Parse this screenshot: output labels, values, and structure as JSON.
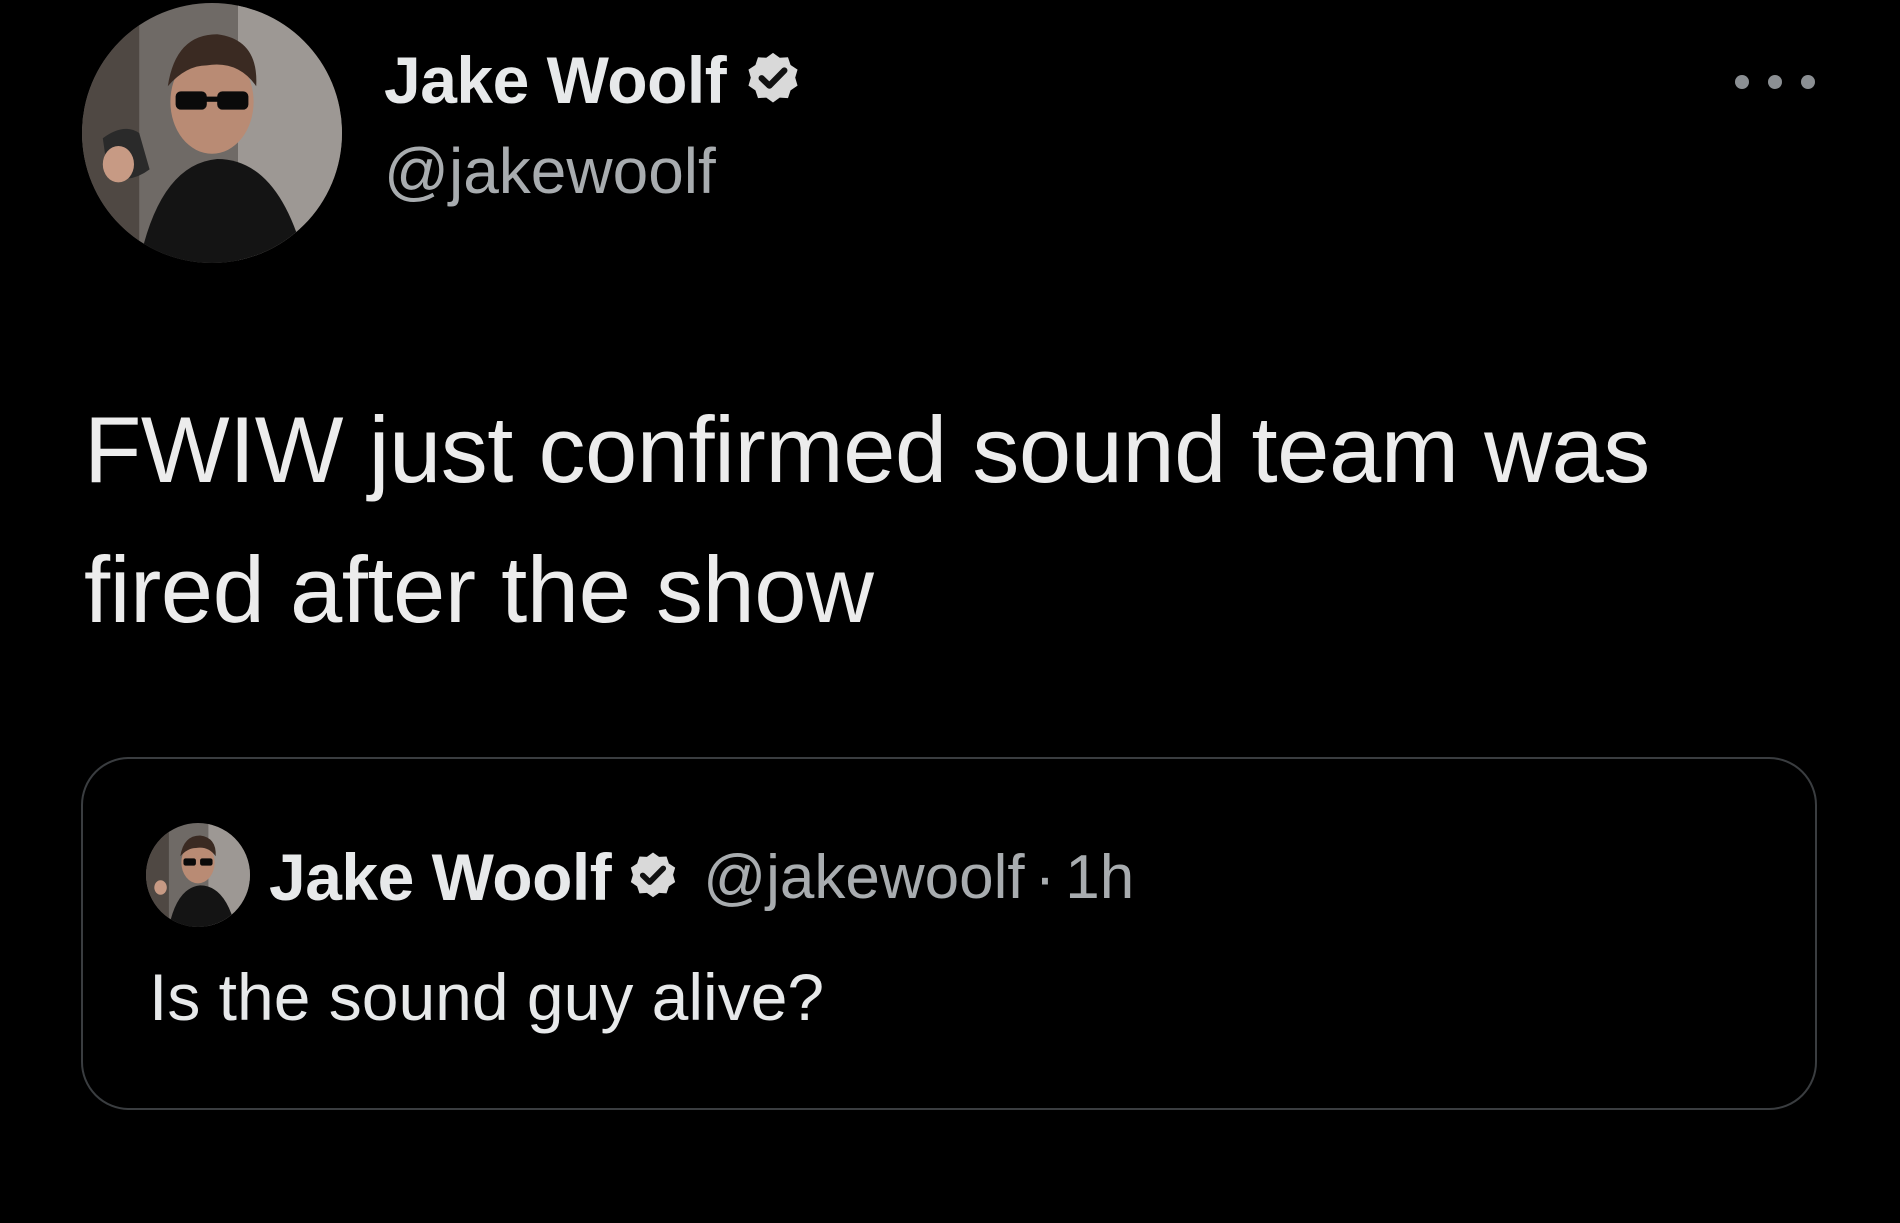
{
  "tweet": {
    "author": {
      "display_name": "Jake Woolf",
      "handle": "@jakewoolf",
      "verified": true,
      "avatar_icon": "avatar-photo"
    },
    "more_icon": "more-options-icon",
    "text": "FWIW just confirmed sound team was fired after the show",
    "quoted_tweet": {
      "author": {
        "display_name": "Jake Woolf",
        "handle": "@jakewoolf",
        "verified": true
      },
      "separator": "·",
      "time": "1h",
      "text": "Is the sound guy alive?"
    }
  },
  "colors": {
    "background": "#000000",
    "primary_text": "#e7e9ea",
    "secondary_text": "#a8acaf",
    "card_border": "#3a3d40"
  }
}
